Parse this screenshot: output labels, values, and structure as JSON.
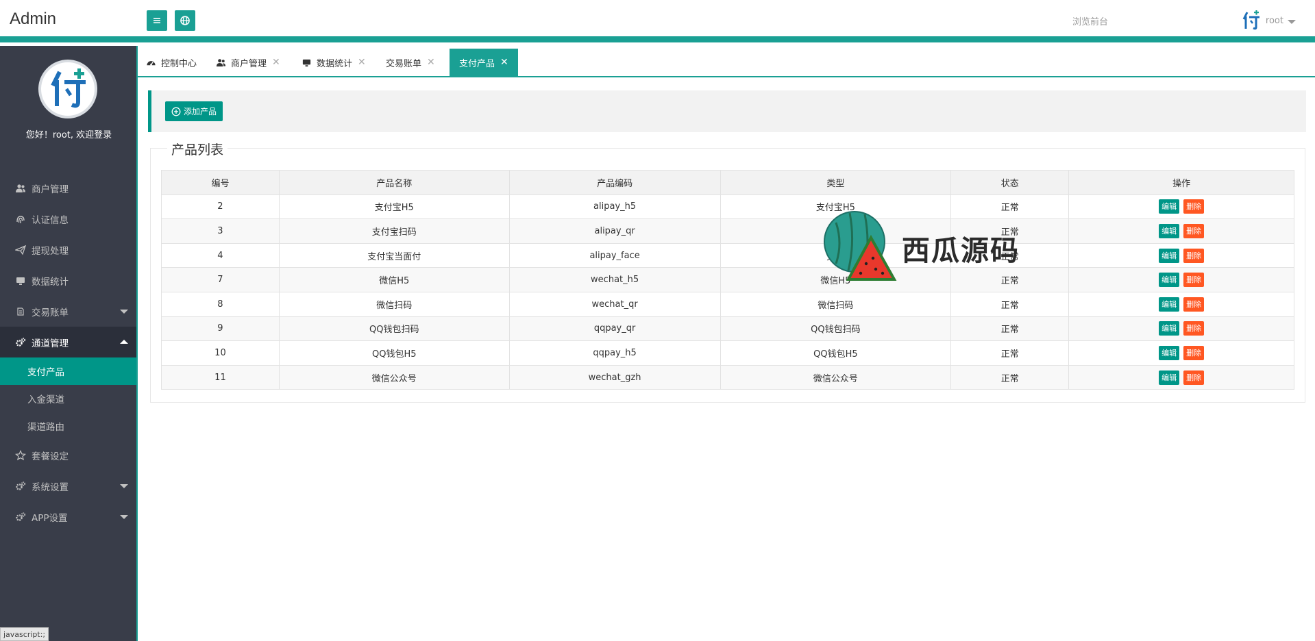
{
  "header": {
    "brand": "Admin",
    "front_link": "浏览前台",
    "user_name": "root"
  },
  "sidebar": {
    "welcome": "您好！root, 欢迎登录",
    "menu": [
      {
        "label": "商户管理",
        "icon": "users-icon"
      },
      {
        "label": "认证信息",
        "icon": "fingerprint-icon"
      },
      {
        "label": "提现处理",
        "icon": "paper-plane-icon"
      },
      {
        "label": "数据统计",
        "icon": "monitor-icon"
      },
      {
        "label": "交易账单",
        "icon": "list-icon"
      },
      {
        "label": "通道管理",
        "icon": "gears-icon"
      },
      {
        "label": "套餐设定",
        "icon": "star-icon"
      },
      {
        "label": "系统设置",
        "icon": "gears-icon"
      },
      {
        "label": "APP设置",
        "icon": "gears-icon"
      }
    ],
    "submenu": [
      "支付产品",
      "入金渠道",
      "渠道路由"
    ],
    "status_tip": "javascript:;"
  },
  "tabs": [
    {
      "label": "控制中心",
      "icon": "dashboard-icon"
    },
    {
      "label": "商户管理",
      "icon": "users-icon"
    },
    {
      "label": "数据统计",
      "icon": "monitor-icon"
    },
    {
      "label": "交易账单",
      "icon": ""
    },
    {
      "label": "支付产品",
      "icon": ""
    }
  ],
  "toolbar": {
    "add_label": "添加产品"
  },
  "table": {
    "legend": "产品列表",
    "columns": [
      "编号",
      "产品名称",
      "产品编码",
      "类型",
      "状态",
      "操作"
    ],
    "edit_label": "编辑",
    "delete_label": "删除",
    "rows": [
      [
        "2",
        "支付宝H5",
        "alipay_h5",
        "支付宝H5",
        "正常"
      ],
      [
        "3",
        "支付宝扫码",
        "alipay_qr",
        "支付",
        "正常"
      ],
      [
        "4",
        "支付宝当面付",
        "alipay_face",
        "支付",
        "正常"
      ],
      [
        "7",
        "微信H5",
        "wechat_h5",
        "微信H5",
        "正常"
      ],
      [
        "8",
        "微信扫码",
        "wechat_qr",
        "微信扫码",
        "正常"
      ],
      [
        "9",
        "QQ钱包扫码",
        "qqpay_qr",
        "QQ钱包扫码",
        "正常"
      ],
      [
        "10",
        "QQ钱包H5",
        "qqpay_h5",
        "QQ钱包H5",
        "正常"
      ],
      [
        "11",
        "微信公众号",
        "wechat_gzh",
        "微信公众号",
        "正常"
      ]
    ]
  },
  "watermark": {
    "text": "西瓜源码"
  },
  "colors": {
    "accent": "#1aa094",
    "primary": "#009688",
    "danger": "#ff5722",
    "sidebar_bg": "#393d49"
  }
}
